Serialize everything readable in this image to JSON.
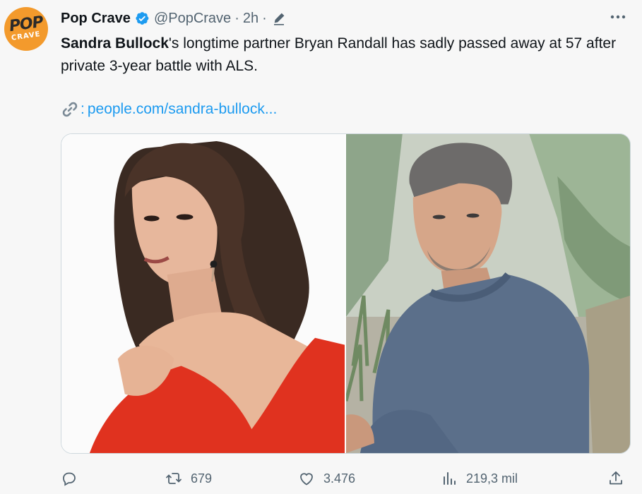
{
  "account": {
    "name": "Pop Crave",
    "handle": "@PopCrave",
    "separator": "·",
    "time": "2h",
    "separator2": "·",
    "avatar_top": "POP",
    "avatar_bottom": "CRAVE"
  },
  "tweet": {
    "bold_lead": "Sandra Bullock",
    "text_rest": "'s longtime partner Bryan Randall has sadly passed away at 57 after private 3-year battle with ALS.",
    "link_emoji": "link-icon",
    "link_colon": ":",
    "link_text": "people.com/sandra-bullock..."
  },
  "media": {
    "left_photo": "photo-sandra-bullock",
    "right_photo": "photo-bryan-randall"
  },
  "actions": {
    "reply_count": "",
    "retweet_count": "679",
    "like_count": "3.476",
    "views_count": "219,3 mil"
  },
  "colors": {
    "accent": "#1d9bf0",
    "secondary_text": "#536471",
    "avatar_bg": "#f39a2c"
  }
}
